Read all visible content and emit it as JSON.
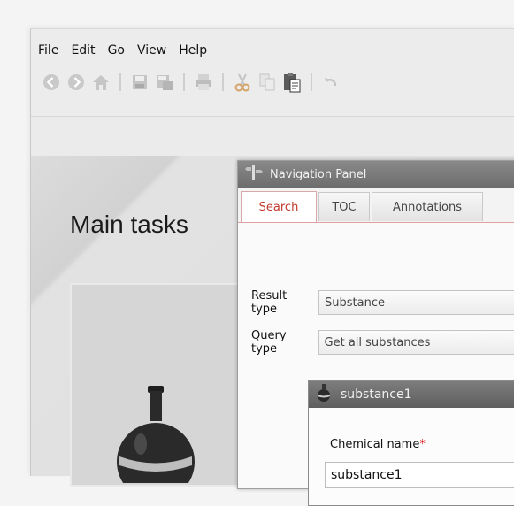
{
  "menu": {
    "items": [
      "File",
      "Edit",
      "Go",
      "View",
      "Help"
    ]
  },
  "toolbar": {
    "icons": [
      "back-icon",
      "forward-icon",
      "home-icon",
      "save-icon",
      "save-as-icon",
      "print-icon",
      "cut-icon",
      "copy-icon",
      "paste-icon",
      "undo-icon"
    ]
  },
  "main": {
    "title": "Main tasks"
  },
  "nav_panel": {
    "title": "Navigation Panel",
    "tabs": [
      {
        "label": "Search",
        "active": true
      },
      {
        "label": "TOC",
        "active": false
      },
      {
        "label": "Annotations",
        "active": false
      }
    ],
    "result_type_label": "Result type",
    "result_type_value": "Substance",
    "query_type_label": "Query type",
    "query_type_value": "Get all substances"
  },
  "substance_window": {
    "title": "substance1",
    "chemical_name_label": "Chemical name",
    "required_marker": "*",
    "chemical_name_value": "substance1"
  },
  "colors": {
    "accent_tab": "#c0392b",
    "header_dark": "#6d6d6d"
  }
}
